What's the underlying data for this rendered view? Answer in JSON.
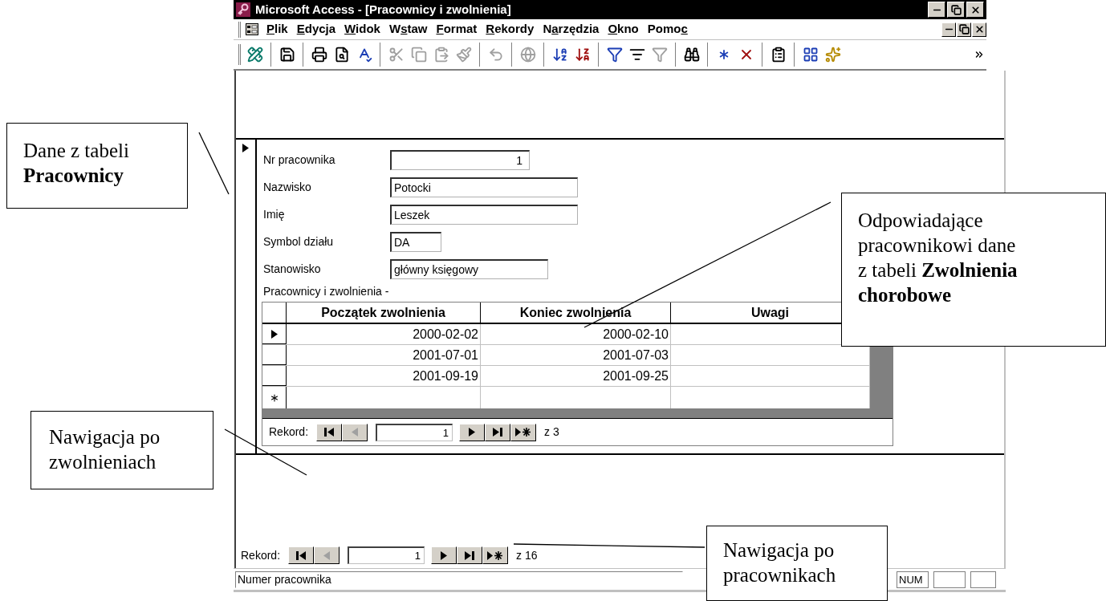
{
  "window": {
    "title": "Microsoft Access - [Pracownicy i zwolnienia]"
  },
  "menu": [
    {
      "key": "P",
      "post": "lik"
    },
    {
      "key": "E",
      "post": "dycja"
    },
    {
      "key": "W",
      "post": "idok"
    },
    {
      "pre": "W",
      "key": "s",
      "post": "taw"
    },
    {
      "key": "F",
      "post": "ormat"
    },
    {
      "key": "R",
      "post": "ekordy"
    },
    {
      "pre": "N",
      "key": "a",
      "post": "rzędzia"
    },
    {
      "key": "O",
      "post": "kno"
    },
    {
      "pre": "Pomo",
      "key": "c"
    }
  ],
  "toolbar": [
    [
      {
        "kind": "design",
        "disabled": false
      }
    ],
    [
      {
        "kind": "save",
        "disabled": false
      }
    ],
    [
      {
        "kind": "print",
        "disabled": false
      },
      {
        "kind": "preview",
        "disabled": false
      },
      {
        "kind": "spelling",
        "disabled": false
      }
    ],
    [
      {
        "kind": "cut",
        "disabled": true
      },
      {
        "kind": "copy",
        "disabled": true
      },
      {
        "kind": "paste",
        "disabled": true
      },
      {
        "kind": "painter",
        "disabled": true
      }
    ],
    [
      {
        "kind": "undo",
        "disabled": true
      }
    ],
    [
      {
        "kind": "web",
        "disabled": true
      }
    ],
    [
      {
        "kind": "sort-asc",
        "disabled": false
      },
      {
        "kind": "sort-desc",
        "disabled": false
      }
    ],
    [
      {
        "kind": "filter-selection",
        "disabled": false
      },
      {
        "kind": "filter-form",
        "disabled": false
      },
      {
        "kind": "filter",
        "disabled": true
      }
    ],
    [
      {
        "kind": "find",
        "disabled": false
      }
    ],
    [
      {
        "kind": "new-record",
        "disabled": false
      },
      {
        "kind": "delete-record",
        "disabled": false
      }
    ],
    [
      {
        "kind": "properties",
        "disabled": false
      }
    ],
    [
      {
        "kind": "database",
        "disabled": false
      },
      {
        "kind": "new-object",
        "disabled": false
      }
    ]
  ],
  "form": {
    "record_current": true,
    "fields": [
      {
        "label": "Nr pracownika",
        "value": "1",
        "kind": "number"
      },
      {
        "label": "Nazwisko",
        "value": "Potocki",
        "kind": "text"
      },
      {
        "label": "Imię",
        "value": "Leszek",
        "kind": "text"
      },
      {
        "label": "Symbol działu",
        "value": "DA",
        "kind": "text"
      },
      {
        "label": "Stanowisko",
        "value": "główny księgowy",
        "kind": "text"
      }
    ],
    "subform": {
      "label": "Pracownicy i zwolnienia -",
      "columns": [
        "Początek zwolnienia",
        "Koniec zwolnienia",
        "Uwagi"
      ],
      "rows": [
        {
          "current": true,
          "cells": [
            "2000-02-02",
            "2000-02-10"
          ]
        },
        {
          "current": false,
          "cells": [
            "2001-07-01",
            "2001-07-03"
          ]
        },
        {
          "current": false,
          "cells": [
            "2001-09-19",
            "2001-09-25"
          ]
        }
      ],
      "new_row": true,
      "navigation": {
        "label": "Rekord:",
        "value": "1",
        "total": "z 3",
        "prev_disabled": true
      }
    },
    "navigation": {
      "label": "Rekord:",
      "value": "1",
      "total": "z 16",
      "prev_disabled": true
    }
  },
  "status_bar": {
    "message": "Numer pracownika",
    "indicator": "NUM"
  },
  "annotations": [
    {
      "text": "Dane z tabeli **Pracownicy**"
    },
    {
      "text": "Odpowiadające pracownikowi dane z tabeli **Zwolnienia chorobowe**"
    },
    {
      "text": "Nawigacja po zwolnieniach"
    },
    {
      "text": "Nawigacja po pracownikach"
    }
  ]
}
